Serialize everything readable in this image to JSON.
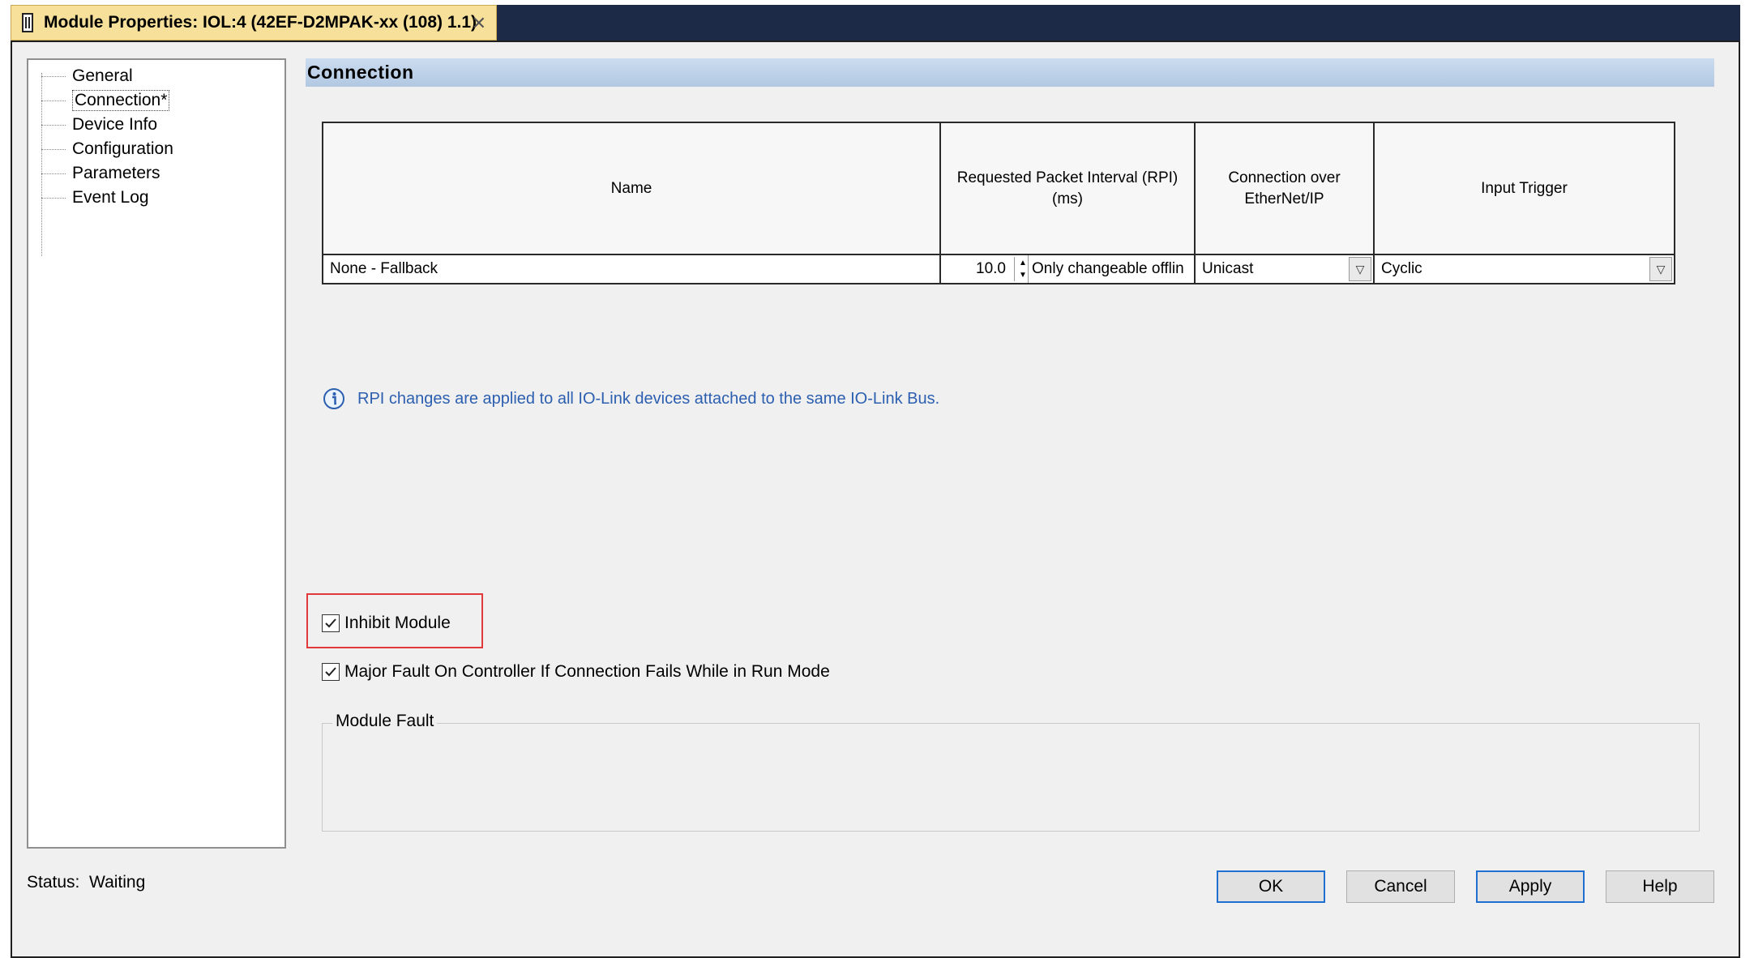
{
  "window": {
    "tab_title": "Module Properties: IOL:4 (42EF-D2MPAK-xx (108) 1.1)",
    "close_glyph": "✕"
  },
  "sidebar": {
    "items": [
      {
        "label": "General",
        "selected": false
      },
      {
        "label": "Connection*",
        "selected": true
      },
      {
        "label": "Device Info",
        "selected": false
      },
      {
        "label": "Configuration",
        "selected": false
      },
      {
        "label": "Parameters",
        "selected": false
      },
      {
        "label": "Event Log",
        "selected": false
      }
    ]
  },
  "section": {
    "title": "Connection"
  },
  "connection_table": {
    "headers": {
      "name": "Name",
      "rpi_line1": "Requested Packet Interval (RPI)",
      "rpi_line2": "(ms)",
      "conn_line1": "Connection over",
      "conn_line2": "EtherNet/IP",
      "trigger": "Input Trigger"
    },
    "row": {
      "name": "None - Fallback",
      "rpi_value": "10.0",
      "rpi_note": "Only changeable offlin",
      "connection": "Unicast",
      "trigger": "Cyclic"
    }
  },
  "info_message": "RPI changes are applied to all IO-Link devices attached to the same IO-Link Bus.",
  "options": {
    "inhibit_module": {
      "label": "Inhibit Module",
      "checked": true
    },
    "major_fault": {
      "label": "Major Fault On Controller If Connection Fails While in Run Mode",
      "checked": true
    }
  },
  "module_fault": {
    "label": "Module Fault"
  },
  "status": {
    "label": "Status:",
    "value": "Waiting"
  },
  "buttons": {
    "ok": "OK",
    "cancel": "Cancel",
    "apply": "Apply",
    "help": "Help"
  },
  "colors": {
    "title_bar": "#1c2a48",
    "tab_bg": "#f7e19a",
    "highlight_box": "#e0383b",
    "info_text": "#2c5fb0"
  }
}
